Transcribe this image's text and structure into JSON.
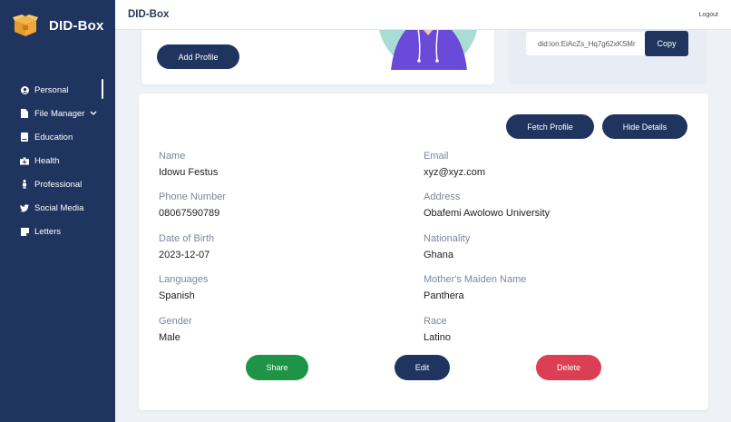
{
  "brand": {
    "title": "DID-Box",
    "icon": "box-icon"
  },
  "sidebar": {
    "items": [
      {
        "label": "Personal",
        "icon": "user-circle-icon",
        "active": true
      },
      {
        "label": "File Manager",
        "icon": "file-icon",
        "has_caret": true
      },
      {
        "label": "Education",
        "icon": "book-icon"
      },
      {
        "label": "Health",
        "icon": "health-icon"
      },
      {
        "label": "Professional",
        "icon": "person-icon"
      },
      {
        "label": "Social Media",
        "icon": "twitter-icon"
      },
      {
        "label": "Letters",
        "icon": "note-icon"
      }
    ]
  },
  "header": {
    "title": "DID-Box",
    "logout": "Logout"
  },
  "profile_card": {
    "add_profile": "Add Profile"
  },
  "did_card": {
    "did_value": "did:ion:EiAcZs_Hq7g62xKSMr",
    "copy": "Copy"
  },
  "details": {
    "fetch_profile": "Fetch Profile",
    "hide_details": "Hide Details",
    "fields": [
      {
        "label": "Name",
        "value": "Idowu Festus"
      },
      {
        "label": "Email",
        "value": "xyz@xyz.com"
      },
      {
        "label": "Phone Number",
        "value": "08067590789"
      },
      {
        "label": "Address",
        "value": "Obafemi Awolowo University"
      },
      {
        "label": "Date of Birth",
        "value": "2023-12-07"
      },
      {
        "label": "Nationality",
        "value": "Ghana"
      },
      {
        "label": "Languages",
        "value": "Spanish"
      },
      {
        "label": "Mother's Maiden Name",
        "value": "Panthera"
      },
      {
        "label": "Gender",
        "value": "Male"
      },
      {
        "label": "Race",
        "value": "Latino"
      }
    ],
    "share": "Share",
    "edit": "Edit",
    "delete": "Delete"
  },
  "colors": {
    "navy": "#1f3560",
    "green": "#1e9447",
    "red": "#dc3f54"
  }
}
